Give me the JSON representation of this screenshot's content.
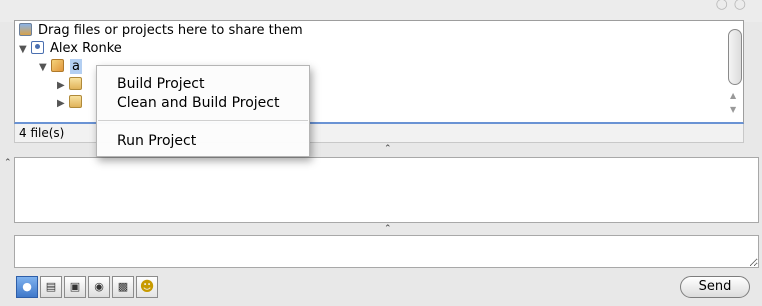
{
  "tree": {
    "drop_hint": "Drag files or projects here to share them",
    "user": "Alex Ronke",
    "project_partial": "a"
  },
  "status": {
    "file_count": "4 file(s)"
  },
  "context_menu": {
    "items": [
      "Build Project",
      "Clean and Build Project",
      "Run Project"
    ]
  },
  "input": {
    "value": ""
  },
  "toolbar": {
    "tools": [
      "chat",
      "document",
      "image",
      "file",
      "file-add",
      "smiley"
    ],
    "send_label": "Send"
  }
}
